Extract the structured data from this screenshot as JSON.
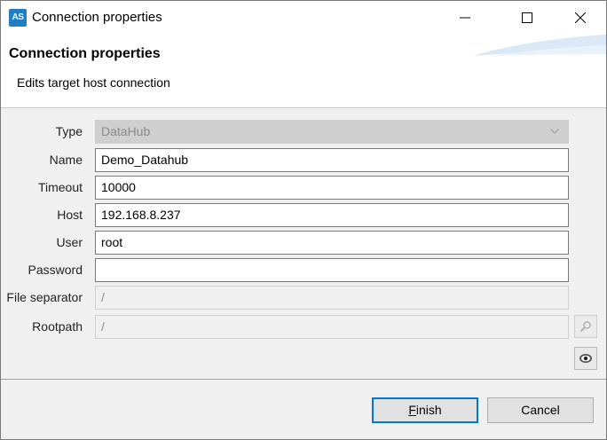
{
  "titlebar": {
    "app_icon": "AS",
    "title": "Connection properties"
  },
  "header": {
    "title": "Connection properties",
    "description": "Edits target host connection"
  },
  "form": {
    "type": {
      "label": "Type",
      "value": "DataHub"
    },
    "name": {
      "label": "Name",
      "value": "Demo_Datahub"
    },
    "timeout": {
      "label": "Timeout",
      "value": "10000"
    },
    "host": {
      "label": "Host",
      "value": "192.168.8.237"
    },
    "user": {
      "label": "User",
      "value": "root"
    },
    "password": {
      "label": "Password",
      "value": ""
    },
    "file_separator": {
      "label": "File separator",
      "value": "/"
    },
    "rootpath": {
      "label": "Rootpath",
      "value": "/"
    }
  },
  "buttons": {
    "finish_mnemonic": "F",
    "finish_rest": "inish",
    "cancel": "Cancel"
  },
  "icons": [
    "minimize-icon",
    "maximize-icon",
    "close-icon",
    "search-icon",
    "eye-icon",
    "chevron-down-icon"
  ]
}
